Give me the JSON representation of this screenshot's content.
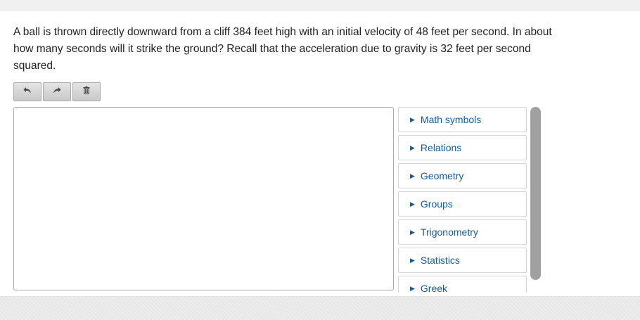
{
  "question": {
    "text": "A ball is thrown directly downward from a cliff 384 feet high with an initial velocity of 48 feet per second. In about how many seconds will it strike the ground? Recall that the acceleration due to gravity is 32 feet per second squared."
  },
  "toolbar": {
    "buttons": [
      {
        "icon": "undo-icon"
      },
      {
        "icon": "redo-icon"
      },
      {
        "icon": "trash-icon"
      }
    ]
  },
  "answer": {
    "value": ""
  },
  "palette": {
    "items": [
      {
        "label": "Math symbols"
      },
      {
        "label": "Relations"
      },
      {
        "label": "Geometry"
      },
      {
        "label": "Groups"
      },
      {
        "label": "Trigonometry"
      },
      {
        "label": "Statistics"
      },
      {
        "label": "Greek"
      }
    ]
  },
  "colors": {
    "link": "#1a5a96",
    "button_bg": "#d4d4d4",
    "scrollbar": "#a0a0a0"
  }
}
